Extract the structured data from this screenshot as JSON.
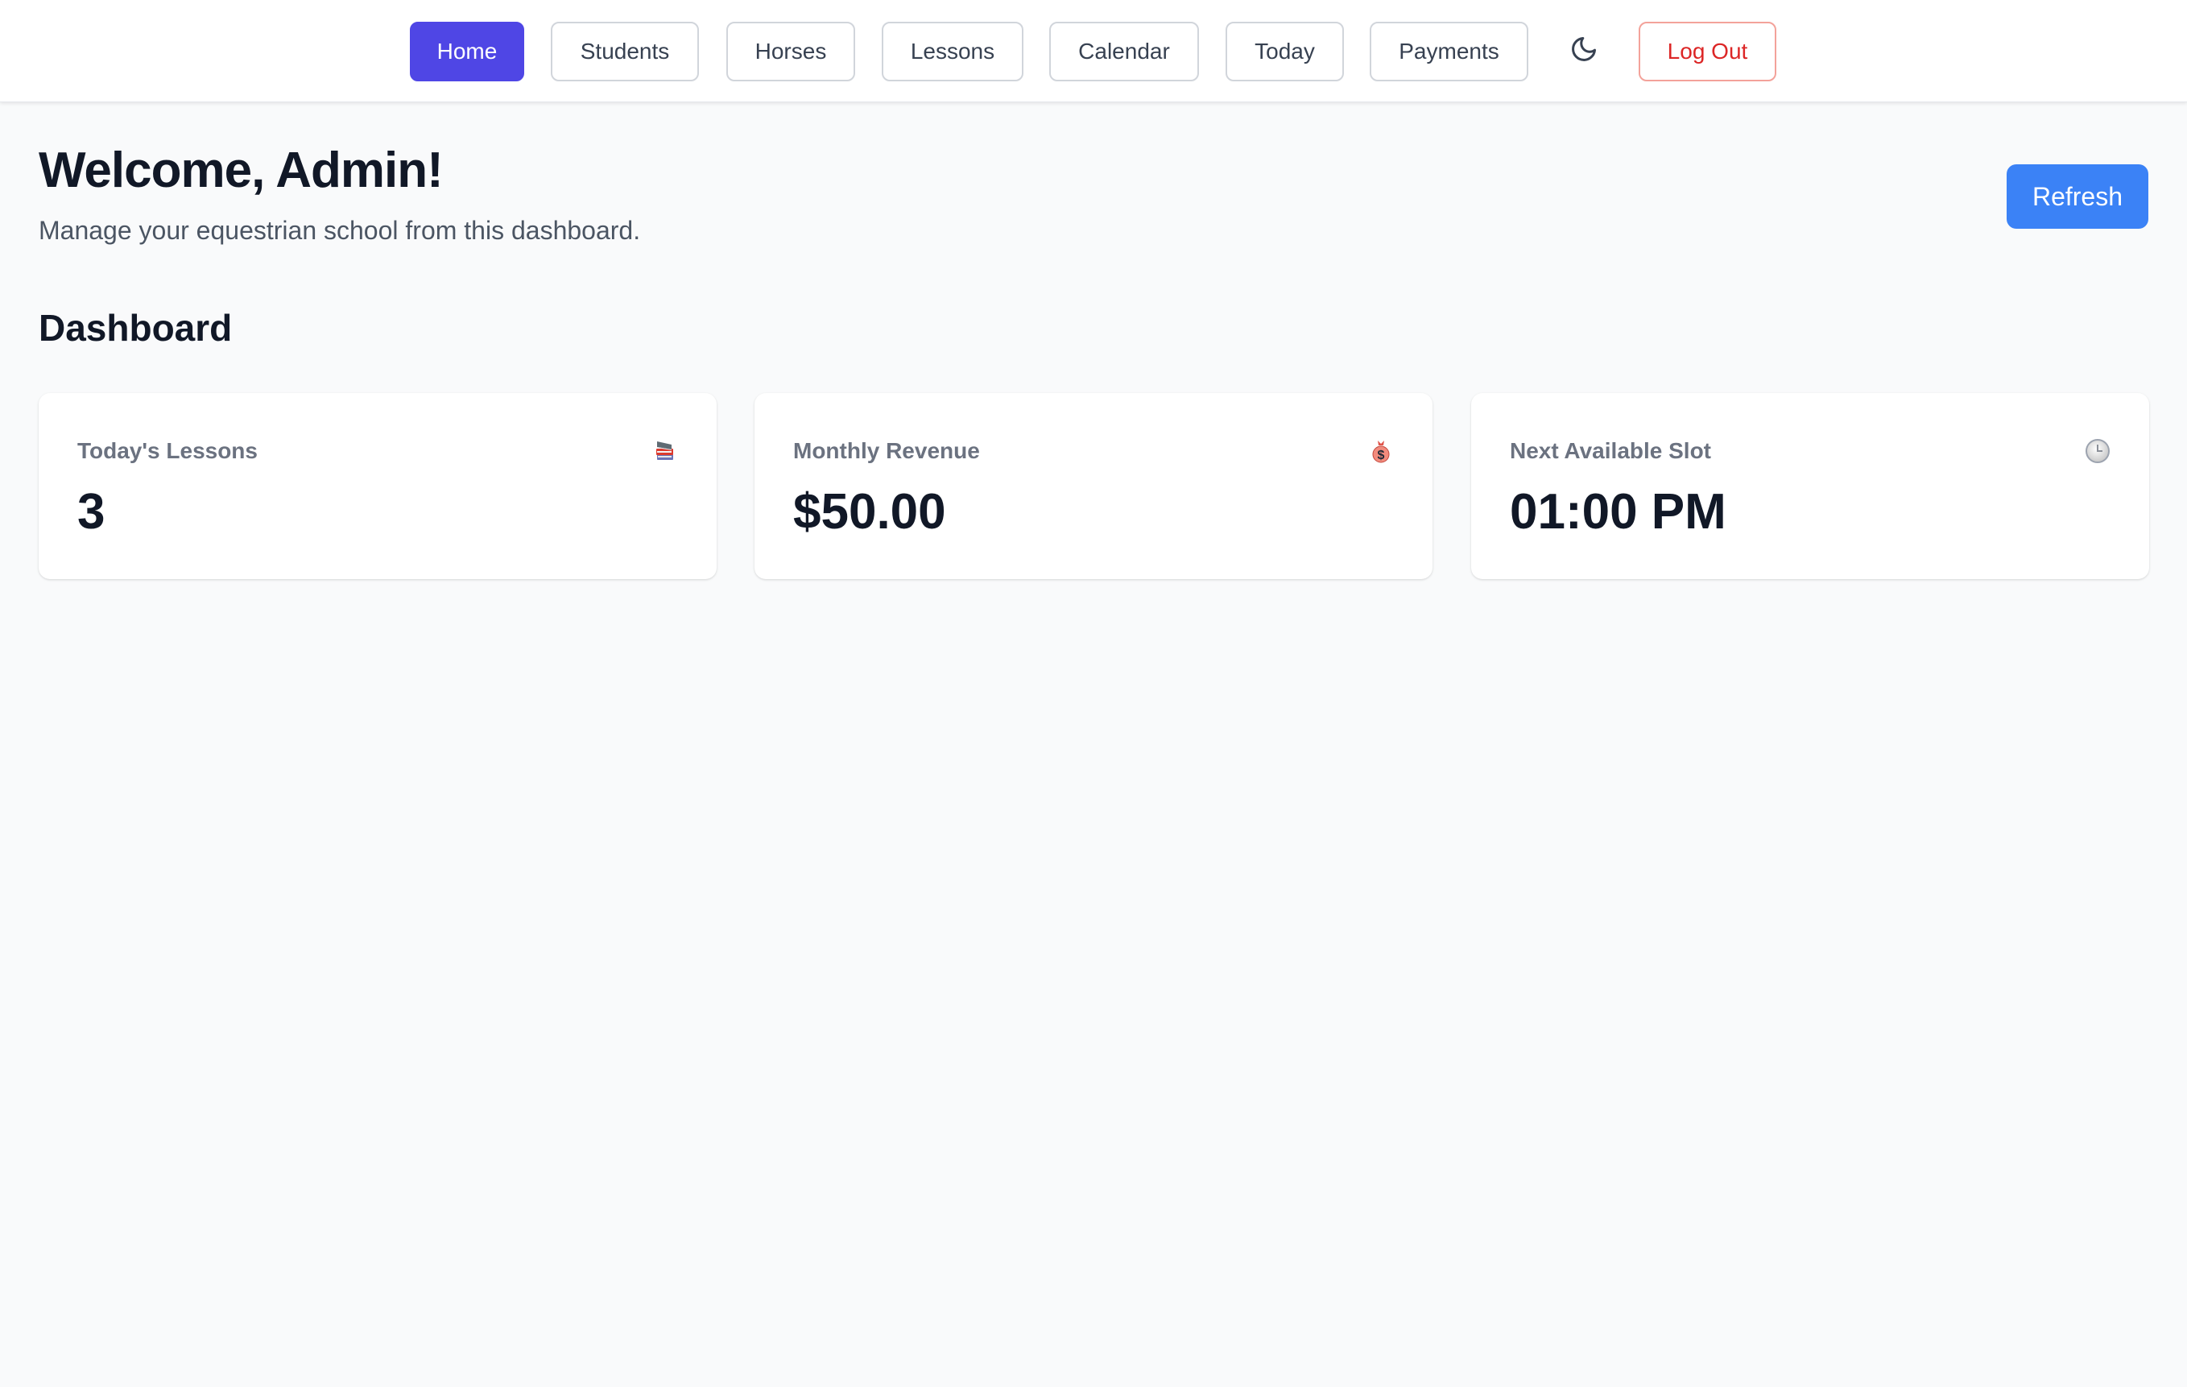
{
  "nav": {
    "items": [
      {
        "label": "Home",
        "active": true
      },
      {
        "label": "Students",
        "active": false
      },
      {
        "label": "Horses",
        "active": false
      },
      {
        "label": "Lessons",
        "active": false
      },
      {
        "label": "Calendar",
        "active": false
      },
      {
        "label": "Today",
        "active": false
      },
      {
        "label": "Payments",
        "active": false
      }
    ],
    "theme_toggle_icon": "moon-icon",
    "logout_label": "Log Out"
  },
  "header": {
    "title": "Welcome, Admin!",
    "subtitle": "Manage your equestrian school from this dashboard.",
    "refresh_label": "Refresh"
  },
  "dashboard": {
    "title": "Dashboard",
    "cards": [
      {
        "label": "Today's Lessons",
        "value": "3",
        "icon": "books-icon"
      },
      {
        "label": "Monthly Revenue",
        "value": "$50.00",
        "icon": "money-bag-icon"
      },
      {
        "label": "Next Available Slot",
        "value": "01:00 PM",
        "icon": "clock-icon"
      }
    ]
  },
  "colors": {
    "primary": "#4f46e5",
    "refresh": "#3b82f6",
    "danger": "#dc2626",
    "background": "#f9fafb"
  }
}
